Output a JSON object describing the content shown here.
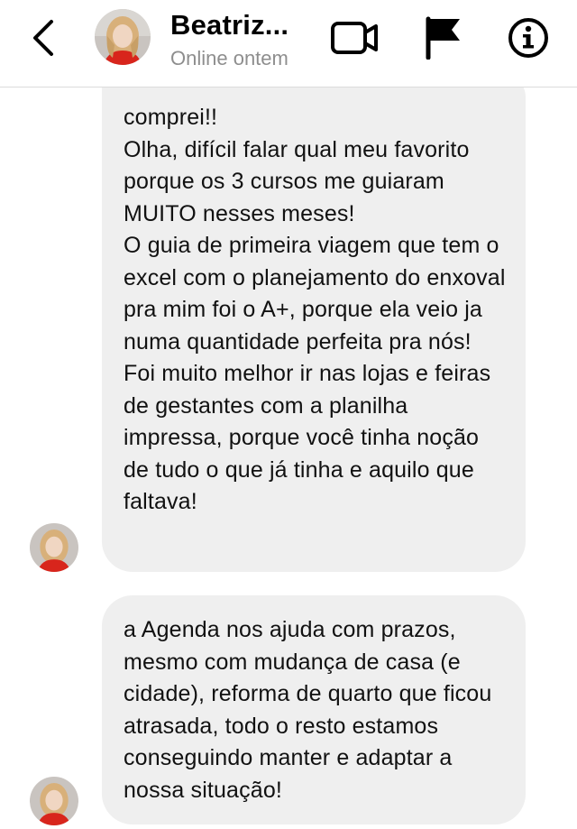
{
  "header": {
    "contact_name": "Beatriz...",
    "status": "Online ontem"
  },
  "icons": {
    "back": "chevron-left-icon",
    "video": "video-camera-icon",
    "flag": "flag-icon",
    "info": "info-circle-icon"
  },
  "messages": [
    {
      "sender": "Beatriz",
      "text": "comprei!!\nOlha, difícil falar qual meu favorito porque os 3 cursos me guiaram MUITO nesses meses!\nO guia de primeira viagem que tem o excel com o planejamento do enxoval pra mim foi o A+, porque ela veio ja numa quantidade perfeita pra nós! Foi muito melhor ir nas lojas e feiras de gestantes com a planilha impressa, porque você tinha noção de tudo o que já tinha e aquilo que faltava!"
    },
    {
      "sender": "Beatriz",
      "text": "a Agenda nos ajuda com prazos, mesmo com mudança de casa (e cidade), reforma de quarto que ficou atrasada, todo o resto estamos conseguindo manter e adaptar a nossa situação!"
    }
  ],
  "colors": {
    "bubble": "#efefef",
    "status_text": "#8e8e8e",
    "divider": "#dcdcdc"
  }
}
